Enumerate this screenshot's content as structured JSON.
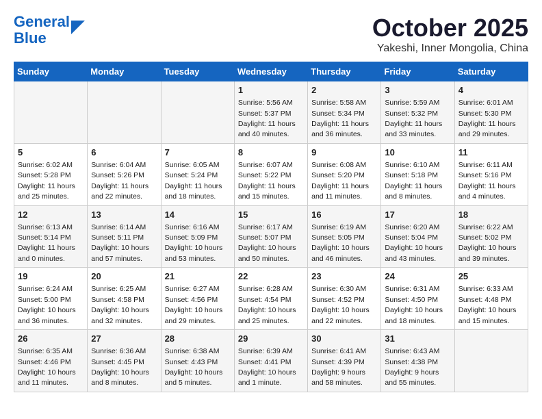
{
  "header": {
    "logo_line1": "General",
    "logo_line2": "Blue",
    "title": "October 2025",
    "subtitle": "Yakeshi, Inner Mongolia, China"
  },
  "columns": [
    "Sunday",
    "Monday",
    "Tuesday",
    "Wednesday",
    "Thursday",
    "Friday",
    "Saturday"
  ],
  "weeks": [
    [
      {
        "day": "",
        "info": ""
      },
      {
        "day": "",
        "info": ""
      },
      {
        "day": "",
        "info": ""
      },
      {
        "day": "1",
        "info": "Sunrise: 5:56 AM\nSunset: 5:37 PM\nDaylight: 11 hours\nand 40 minutes."
      },
      {
        "day": "2",
        "info": "Sunrise: 5:58 AM\nSunset: 5:34 PM\nDaylight: 11 hours\nand 36 minutes."
      },
      {
        "day": "3",
        "info": "Sunrise: 5:59 AM\nSunset: 5:32 PM\nDaylight: 11 hours\nand 33 minutes."
      },
      {
        "day": "4",
        "info": "Sunrise: 6:01 AM\nSunset: 5:30 PM\nDaylight: 11 hours\nand 29 minutes."
      }
    ],
    [
      {
        "day": "5",
        "info": "Sunrise: 6:02 AM\nSunset: 5:28 PM\nDaylight: 11 hours\nand 25 minutes."
      },
      {
        "day": "6",
        "info": "Sunrise: 6:04 AM\nSunset: 5:26 PM\nDaylight: 11 hours\nand 22 minutes."
      },
      {
        "day": "7",
        "info": "Sunrise: 6:05 AM\nSunset: 5:24 PM\nDaylight: 11 hours\nand 18 minutes."
      },
      {
        "day": "8",
        "info": "Sunrise: 6:07 AM\nSunset: 5:22 PM\nDaylight: 11 hours\nand 15 minutes."
      },
      {
        "day": "9",
        "info": "Sunrise: 6:08 AM\nSunset: 5:20 PM\nDaylight: 11 hours\nand 11 minutes."
      },
      {
        "day": "10",
        "info": "Sunrise: 6:10 AM\nSunset: 5:18 PM\nDaylight: 11 hours\nand 8 minutes."
      },
      {
        "day": "11",
        "info": "Sunrise: 6:11 AM\nSunset: 5:16 PM\nDaylight: 11 hours\nand 4 minutes."
      }
    ],
    [
      {
        "day": "12",
        "info": "Sunrise: 6:13 AM\nSunset: 5:14 PM\nDaylight: 11 hours\nand 0 minutes."
      },
      {
        "day": "13",
        "info": "Sunrise: 6:14 AM\nSunset: 5:11 PM\nDaylight: 10 hours\nand 57 minutes."
      },
      {
        "day": "14",
        "info": "Sunrise: 6:16 AM\nSunset: 5:09 PM\nDaylight: 10 hours\nand 53 minutes."
      },
      {
        "day": "15",
        "info": "Sunrise: 6:17 AM\nSunset: 5:07 PM\nDaylight: 10 hours\nand 50 minutes."
      },
      {
        "day": "16",
        "info": "Sunrise: 6:19 AM\nSunset: 5:05 PM\nDaylight: 10 hours\nand 46 minutes."
      },
      {
        "day": "17",
        "info": "Sunrise: 6:20 AM\nSunset: 5:04 PM\nDaylight: 10 hours\nand 43 minutes."
      },
      {
        "day": "18",
        "info": "Sunrise: 6:22 AM\nSunset: 5:02 PM\nDaylight: 10 hours\nand 39 minutes."
      }
    ],
    [
      {
        "day": "19",
        "info": "Sunrise: 6:24 AM\nSunset: 5:00 PM\nDaylight: 10 hours\nand 36 minutes."
      },
      {
        "day": "20",
        "info": "Sunrise: 6:25 AM\nSunset: 4:58 PM\nDaylight: 10 hours\nand 32 minutes."
      },
      {
        "day": "21",
        "info": "Sunrise: 6:27 AM\nSunset: 4:56 PM\nDaylight: 10 hours\nand 29 minutes."
      },
      {
        "day": "22",
        "info": "Sunrise: 6:28 AM\nSunset: 4:54 PM\nDaylight: 10 hours\nand 25 minutes."
      },
      {
        "day": "23",
        "info": "Sunrise: 6:30 AM\nSunset: 4:52 PM\nDaylight: 10 hours\nand 22 minutes."
      },
      {
        "day": "24",
        "info": "Sunrise: 6:31 AM\nSunset: 4:50 PM\nDaylight: 10 hours\nand 18 minutes."
      },
      {
        "day": "25",
        "info": "Sunrise: 6:33 AM\nSunset: 4:48 PM\nDaylight: 10 hours\nand 15 minutes."
      }
    ],
    [
      {
        "day": "26",
        "info": "Sunrise: 6:35 AM\nSunset: 4:46 PM\nDaylight: 10 hours\nand 11 minutes."
      },
      {
        "day": "27",
        "info": "Sunrise: 6:36 AM\nSunset: 4:45 PM\nDaylight: 10 hours\nand 8 minutes."
      },
      {
        "day": "28",
        "info": "Sunrise: 6:38 AM\nSunset: 4:43 PM\nDaylight: 10 hours\nand 5 minutes."
      },
      {
        "day": "29",
        "info": "Sunrise: 6:39 AM\nSunset: 4:41 PM\nDaylight: 10 hours\nand 1 minute."
      },
      {
        "day": "30",
        "info": "Sunrise: 6:41 AM\nSunset: 4:39 PM\nDaylight: 9 hours\nand 58 minutes."
      },
      {
        "day": "31",
        "info": "Sunrise: 6:43 AM\nSunset: 4:38 PM\nDaylight: 9 hours\nand 55 minutes."
      },
      {
        "day": "",
        "info": ""
      }
    ]
  ]
}
